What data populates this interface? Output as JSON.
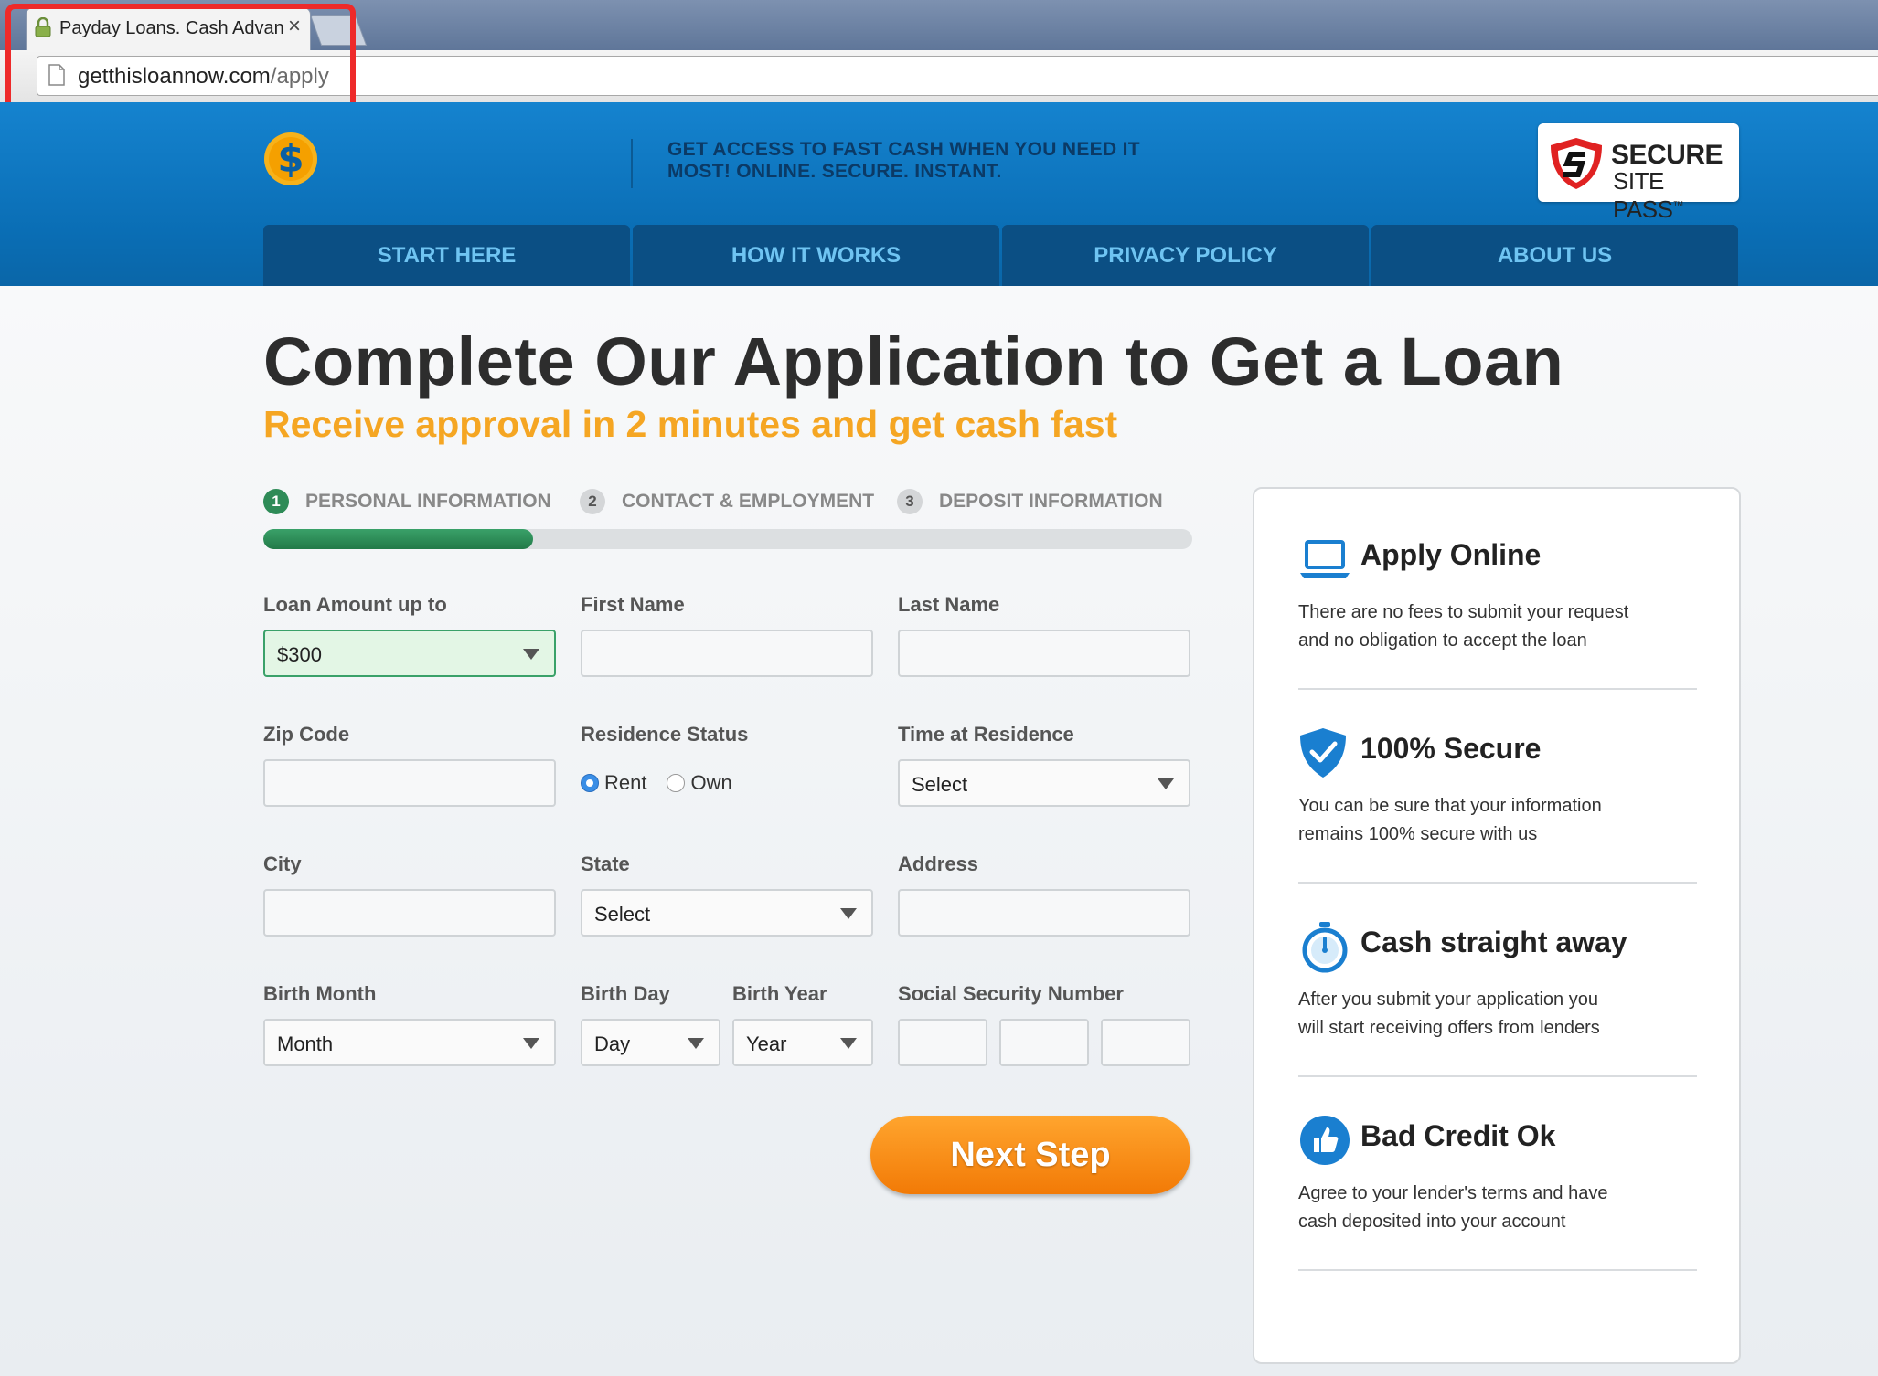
{
  "browser": {
    "tab_title": "Payday Loans. Cash Advan",
    "url_host": "getthisloannow.com",
    "url_path": "/apply"
  },
  "header": {
    "tagline_line1": "GET ACCESS TO FAST CASH WHEN YOU NEED IT",
    "tagline_line2": "MOST! ONLINE. SECURE. INSTANT.",
    "badge_line1": "SECURE",
    "badge_line2": "SITE PASS",
    "badge_mark": "™",
    "logo_icon": "dollar-coin-icon",
    "nav": [
      "START HERE",
      "HOW IT WORKS",
      "PRIVACY POLICY",
      "ABOUT US"
    ]
  },
  "page": {
    "title": "Complete Our Application to Get a Loan",
    "subtitle": "Receive approval in 2 minutes and get cash fast"
  },
  "steps": [
    {
      "num": "1",
      "label": "PERSONAL INFORMATION"
    },
    {
      "num": "2",
      "label": "CONTACT & EMPLOYMENT"
    },
    {
      "num": "3",
      "label": "DEPOSIT INFORMATION"
    }
  ],
  "progress": 0.29,
  "form": {
    "loan_amount_label": "Loan Amount up to",
    "loan_amount_value": "$300",
    "first_name_label": "First Name",
    "last_name_label": "Last Name",
    "zip_label": "Zip Code",
    "residence_label": "Residence Status",
    "residence_options": [
      "Rent",
      "Own"
    ],
    "residence_selected": "Rent",
    "time_residence_label": "Time at Residence",
    "time_residence_value": "Select",
    "city_label": "City",
    "state_label": "State",
    "state_value": "Select",
    "address_label": "Address",
    "birth_month_label": "Birth Month",
    "birth_month_value": "Month",
    "birth_day_label": "Birth Day",
    "birth_day_value": "Day",
    "birth_year_label": "Birth Year",
    "birth_year_value": "Year",
    "ssn_label": "Social Security Number",
    "next_button": "Next Step"
  },
  "sidebar": [
    {
      "icon": "laptop-icon",
      "title": "Apply Online",
      "line1": "There are no fees to submit your request",
      "line2": "and no obligation to accept the loan"
    },
    {
      "icon": "shield-check-icon",
      "title": "100% Secure",
      "line1": "You can be sure that your information",
      "line2": "remains 100% secure with us"
    },
    {
      "icon": "stopwatch-icon",
      "title": "Cash straight away",
      "line1": "After you submit your application you",
      "line2": "will start receiving offers from lenders"
    },
    {
      "icon": "thumbs-up-icon",
      "title": "Bad Credit Ok",
      "line1": "Agree to your lender's terms and have",
      "line2": "cash deposited into your account"
    }
  ],
  "colors": {
    "header_blue": "#0a6eb5",
    "nav_bg": "#0b4f84",
    "nav_text": "#6fc4f2",
    "accent_orange": "#f5a623",
    "progress_green": "#2e8b57",
    "highlight_red": "#ee2a2a"
  }
}
